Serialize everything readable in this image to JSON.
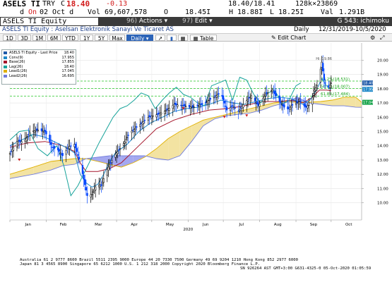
{
  "quote": {
    "ticker": "ASELS TI",
    "currency": "TRY",
    "c_prefix": "C",
    "last": "18.40",
    "change": "-0.13",
    "bid_ask": "18.40/18.41",
    "size": "128k×23869",
    "mode_marker": "d",
    "open_label": "On",
    "open_date": "02 Oct d",
    "vol_label": "Vol",
    "volume": "69,607,578",
    "open_price_label": "O",
    "open_price": "18.45I",
    "high_label": "H",
    "high": "18.88I",
    "low_label": "L",
    "low": "18.25I",
    "val_label": "Val",
    "value": "1.291B"
  },
  "command": {
    "text": "ASELS TI Equity",
    "actions_num": "96)",
    "actions_label": "Actions",
    "edit_num": "97)",
    "edit_label": "Edit",
    "screen_code": "G 543: ichimoku"
  },
  "security_line": {
    "name": "ASELS TI Equity : Aselsan Elektronik Sanayi Ve Ticaret AS",
    "period": "Daily",
    "date_range": "12/31/2019-10/5/2020"
  },
  "toolbar": {
    "ranges": [
      "1D",
      "3D",
      "1M",
      "6M",
      "YTD",
      "1Y",
      "5Y",
      "Max"
    ],
    "frequency": "Daily",
    "table_label": "Table",
    "edit_chart_label": "Edit Chart"
  },
  "legend": {
    "title": "ASELS TI Equity - Last Price",
    "title_value": "18.40",
    "items": [
      {
        "label": "Conv(9)",
        "value": "17.955",
        "color": "#1e88c8"
      },
      {
        "label": "Base(26)",
        "value": "17.855",
        "color": "#a5162b"
      },
      {
        "label": "Lag(26)",
        "value": "18.40",
        "color": "#17a39a"
      },
      {
        "label": "Lead1(26)",
        "value": "17.045",
        "color": "#e0b000"
      },
      {
        "label": "Lead2(26)",
        "value": "16.695",
        "color": "#6f7bdc"
      }
    ]
  },
  "annotations": {
    "hi": "Hi: 19.86",
    "fib1": "38.2%(18.531)",
    "fib2": "50.0%(18.007)",
    "fib3": "61.8%(17.484)"
  },
  "price_labels": [
    {
      "text": "18.40",
      "value": 18.4,
      "color": "#1e5aa8"
    },
    {
      "text": "17.955",
      "value": 17.955,
      "color": "#1e88c8"
    },
    {
      "text": "17.045",
      "value": 17.045,
      "color": "#16a34a"
    }
  ],
  "chart_data": {
    "type": "line",
    "xlabel": "2020",
    "months": [
      "Jan",
      "Feb",
      "Mar",
      "Apr",
      "May",
      "Jun",
      "Jul",
      "Aug",
      "Sep",
      "Oct"
    ],
    "month_days": [
      0,
      31,
      60,
      91,
      121,
      152,
      182,
      213,
      244,
      274
    ],
    "x_unit": "days since 2019-12-31",
    "ylim": [
      8.8,
      21.2
    ],
    "yticks": [
      10,
      11,
      12,
      13,
      14,
      15,
      16,
      17,
      18,
      19,
      20
    ],
    "fib_levels": [
      18.531,
      18.007,
      17.484
    ],
    "fib_color": "#22c422",
    "high_point": {
      "x": 267,
      "y": 19.86
    },
    "colors": {
      "price_up": "#000000",
      "price_down": "#0044ff",
      "conversion": "#1e88c8",
      "base": "#a5162b",
      "lagging": "#17a39a",
      "cloud_bull": "#e0b000",
      "cloud_bear": "#6f7bdc"
    },
    "close": {
      "x": [
        0,
        6,
        12,
        18,
        24,
        30,
        36,
        41,
        45,
        50,
        55,
        60,
        66,
        70,
        74,
        78,
        82,
        86,
        90,
        96,
        102,
        110,
        118,
        126,
        134,
        140,
        148,
        156,
        164,
        172,
        180,
        185,
        190,
        195,
        200,
        206,
        212,
        218,
        224,
        230,
        236,
        242,
        248,
        252,
        256,
        260,
        263,
        266,
        268,
        270,
        272,
        274
      ],
      "y": [
        13.45,
        14.3,
        14.3,
        15.0,
        15.1,
        15.0,
        13.9,
        13.7,
        13.3,
        13.9,
        14.1,
        12.8,
        10.5,
        10.6,
        11.3,
        11.2,
        12.2,
        12.8,
        13.4,
        14.0,
        14.9,
        15.4,
        16.0,
        16.2,
        16.5,
        16.9,
        16.8,
        16.7,
        16.9,
        17.3,
        17.7,
        16.5,
        16.8,
        16.4,
        17.0,
        17.5,
        16.8,
        17.6,
        17.9,
        17.1,
        16.5,
        16.9,
        17.1,
        16.7,
        16.9,
        17.9,
        18.4,
        19.86,
        18.6,
        18.2,
        18.1,
        18.4
      ]
    },
    "conversion_line": {
      "x": [
        0,
        10,
        20,
        30,
        40,
        50,
        55,
        60,
        65,
        70,
        75,
        80,
        85,
        90,
        100,
        110,
        120,
        130,
        140,
        150,
        160,
        170,
        180,
        190,
        200,
        210,
        220,
        230,
        240,
        250,
        256,
        262,
        266,
        270,
        274
      ],
      "y": [
        14.0,
        14.4,
        14.8,
        14.6,
        14.2,
        13.8,
        13.5,
        12.0,
        11.4,
        11.1,
        11.3,
        12.0,
        12.9,
        13.5,
        14.1,
        15.0,
        15.6,
        16.0,
        16.4,
        16.6,
        16.7,
        16.9,
        17.2,
        17.0,
        16.9,
        17.1,
        17.3,
        17.4,
        17.3,
        16.9,
        17.2,
        18.0,
        18.7,
        18.2,
        17.955
      ]
    },
    "base_line": {
      "x": [
        0,
        15,
        30,
        45,
        55,
        60,
        65,
        75,
        85,
        95,
        110,
        125,
        140,
        155,
        170,
        185,
        200,
        215,
        230,
        240,
        250,
        258,
        264,
        270,
        274
      ],
      "y": [
        13.9,
        14.2,
        14.3,
        14.0,
        13.6,
        12.8,
        12.2,
        12.2,
        12.4,
        12.8,
        14.0,
        15.2,
        15.8,
        16.2,
        16.5,
        16.6,
        16.8,
        17.1,
        17.1,
        17.2,
        17.0,
        17.4,
        17.9,
        17.9,
        17.855
      ]
    },
    "lagging_line": {
      "x": [
        0,
        8,
        16,
        24,
        32,
        40,
        46,
        52,
        58,
        64,
        70,
        76,
        82,
        88,
        94,
        100,
        106,
        112,
        118,
        124,
        130,
        136,
        142,
        148,
        154,
        160,
        166,
        172,
        178,
        184,
        190,
        196,
        202,
        208,
        214,
        220,
        226,
        232,
        238,
        244,
        248
      ],
      "y": [
        14.4,
        15.0,
        15.1,
        13.8,
        13.3,
        14.0,
        12.6,
        10.5,
        11.2,
        12.2,
        13.2,
        14.2,
        15.1,
        16.0,
        16.6,
        16.8,
        17.2,
        17.7,
        17.5,
        16.6,
        17.2,
        17.7,
        18.1,
        17.6,
        17.4,
        17.0,
        16.8,
        18.2,
        18.4,
        18.6,
        17.2,
        18.8,
        18.6,
        17.6,
        17.0,
        17.7,
        17.9,
        16.9,
        17.2,
        18.2,
        18.4
      ]
    },
    "cloud": {
      "x": [
        0,
        20,
        35,
        45,
        55,
        65,
        75,
        85,
        95,
        105,
        115,
        125,
        135,
        145,
        155,
        165,
        175,
        185,
        195,
        205,
        215,
        225,
        235,
        245,
        255,
        265,
        275,
        285,
        295,
        300
      ],
      "lead1": [
        12.0,
        12.5,
        12.9,
        13.0,
        13.1,
        13.1,
        12.9,
        12.7,
        12.5,
        12.8,
        13.2,
        13.8,
        14.5,
        15.0,
        15.4,
        15.8,
        16.0,
        16.2,
        16.4,
        16.6,
        16.8,
        17.0,
        17.1,
        17.05,
        17.05,
        17.1,
        17.2,
        17.4,
        17.4,
        17.045
      ],
      "lead2": [
        11.7,
        12.0,
        12.3,
        12.6,
        12.7,
        13.1,
        13.2,
        13.3,
        13.3,
        13.3,
        13.3,
        13.1,
        13.0,
        13.3,
        14.3,
        15.4,
        15.9,
        16.1,
        16.2,
        16.3,
        16.5,
        16.8,
        17.0,
        17.4,
        17.0,
        16.9,
        16.8,
        16.8,
        16.7,
        16.695
      ]
    },
    "red_markers": [
      {
        "x": 8,
        "y": 13.0
      },
      {
        "x": 183,
        "y": 16.0
      },
      {
        "x": 202,
        "y": 16.1
      },
      {
        "x": 148,
        "y": 16.6
      }
    ]
  },
  "footer": {
    "line1": "Australia 61 2 9777 8600 Brazil 5511 2395 9000 Europe 44 20 7330 7500 Germany 49 69 9204 1210 Hong Kong 852 2977 6000",
    "line2": "Japan 81 3 4565 8900       Singapore 65 6212 1000       U.S. 1 212 318 2000           Copyright 2020 Bloomberg Finance L.P.",
    "line3": "SN 926264 AST  GMT+3:00 G631-4325-0 05-Oct-2020 01:05:59"
  }
}
